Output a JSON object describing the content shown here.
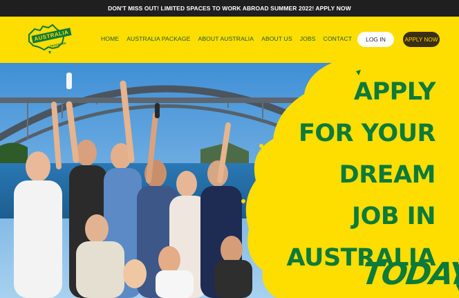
{
  "announcement": "DON'T MISS OUT! LIMITED SPACES TO WORK ABROAD SUMMER 2022! APPLY NOW",
  "logo": {
    "title": "AUSTRALIA",
    "subtitle": "PROGRAMS"
  },
  "nav": {
    "home": "HOME",
    "package": "AUSTRALIA PACKAGE",
    "about_australia": "ABOUT AUSTRALIA",
    "about_us": "ABOUT US",
    "jobs": "JOBS",
    "contact": "CONTACT"
  },
  "buttons": {
    "login": "LOG IN",
    "apply": "APPLY NOW"
  },
  "hero": {
    "lines": [
      "APPLY",
      "FOR YOUR",
      "DREAM",
      "JOB IN",
      "AUSTRALIA"
    ],
    "today": "TODAY"
  },
  "colors": {
    "brand_yellow": "#fedd00",
    "brand_green": "#0c7a3a",
    "apply_button": "#3b2e14",
    "topbar": "#1f1f1f"
  }
}
